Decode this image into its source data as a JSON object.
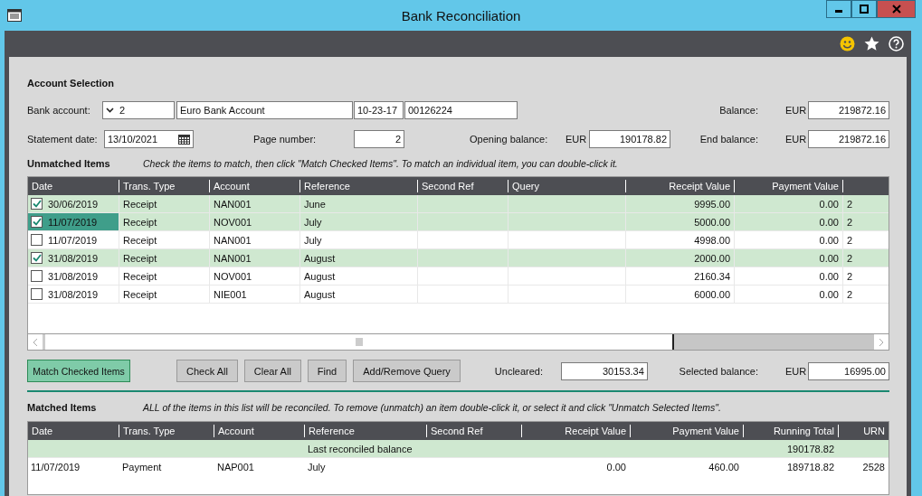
{
  "window": {
    "title": "Bank Reconciliation"
  },
  "account_selection": {
    "heading": "Account Selection",
    "bank_account_label": "Bank account:",
    "bank_account": "2",
    "account_name": "Euro Bank Account",
    "sort_code": "10-23-17",
    "account_number": "00126224",
    "balance_label": "Balance:",
    "balance_currency": "EUR",
    "balance": "219872.16",
    "statement_date_label": "Statement date:",
    "statement_date": "13/10/2021",
    "page_number_label": "Page number:",
    "page_number": "2",
    "opening_balance_label": "Opening balance:",
    "opening_currency": "EUR",
    "opening_balance": "190178.82",
    "end_balance_label": "End balance:",
    "end_currency": "EUR",
    "end_balance": "219872.16"
  },
  "unmatched": {
    "heading": "Unmatched Items",
    "hint": "Check the items to match, then click \"Match Checked Items\". To match an individual item, you can double-click it.",
    "columns": [
      "Date",
      "Trans. Type",
      "Account",
      "Reference",
      "Second Ref",
      "Query",
      "Receipt Value",
      "Payment Value"
    ],
    "rows": [
      {
        "checked": true,
        "focused": false,
        "date": "30/06/2019",
        "type": "Receipt",
        "account": "NAN001",
        "reference": "June",
        "receipt": "9995.00",
        "payment": "0.00",
        "column_9": "2"
      },
      {
        "checked": true,
        "focused": true,
        "date": "11/07/2019",
        "type": "Receipt",
        "account": "NOV001",
        "reference": "July",
        "receipt": "5000.00",
        "payment": "0.00",
        "column_9": "2"
      },
      {
        "checked": false,
        "focused": false,
        "date": "11/07/2019",
        "type": "Receipt",
        "account": "NAN001",
        "reference": "July",
        "receipt": "4998.00",
        "payment": "0.00",
        "column_9": "2"
      },
      {
        "checked": true,
        "focused": false,
        "date": "31/08/2019",
        "type": "Receipt",
        "account": "NAN001",
        "reference": "August",
        "receipt": "2000.00",
        "payment": "0.00",
        "column_9": "2"
      },
      {
        "checked": false,
        "focused": false,
        "date": "31/08/2019",
        "type": "Receipt",
        "account": "NOV001",
        "reference": "August",
        "receipt": "2160.34",
        "payment": "0.00",
        "column_9": "2"
      },
      {
        "checked": false,
        "focused": false,
        "date": "31/08/2019",
        "type": "Receipt",
        "account": "NIE001",
        "reference": "August",
        "receipt": "6000.00",
        "payment": "0.00",
        "column_9": "2"
      }
    ]
  },
  "actions": {
    "buttons": [
      {
        "label": "Match Checked Items",
        "kind": "primary"
      },
      {
        "label": "Check All",
        "kind": "normal"
      },
      {
        "label": "Clear All",
        "kind": "normal"
      },
      {
        "label": "Find",
        "kind": "normal"
      },
      {
        "label": "Add/Remove Query",
        "kind": "normal"
      }
    ],
    "uncleared_label": "Uncleared:",
    "uncleared": "30153.34",
    "selected_balance_label": "Selected balance:",
    "selected_currency": "EUR",
    "selected_balance": "16995.00"
  },
  "matched": {
    "heading": "Matched Items",
    "hint": "ALL of the items in this list will be reconciled. To remove (unmatch) an item double-click it, or select it and click \"Unmatch Selected Items\".",
    "columns": [
      "Date",
      "Trans. Type",
      "Account",
      "Reference",
      "Second Ref",
      "Receipt Value",
      "Payment Value",
      "Running Total",
      "URN"
    ],
    "rows": [
      {
        "kind": "balance",
        "label": "Last reconciled balance",
        "running_total": "190178.82"
      },
      {
        "kind": "entry",
        "date": "11/07/2019",
        "type": "Payment",
        "account": "NAP001",
        "reference": "July",
        "receipt": "0.00",
        "payment": "460.00",
        "running_total": "189718.82",
        "urn": "2528"
      }
    ]
  }
}
